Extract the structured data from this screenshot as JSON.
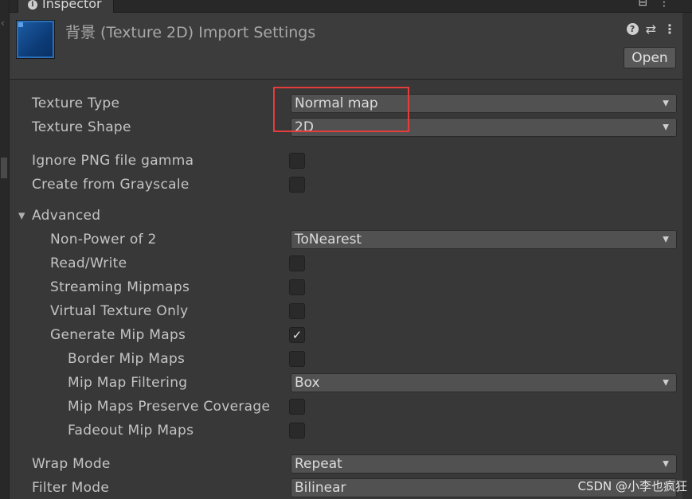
{
  "tab": {
    "label": "Inspector"
  },
  "header": {
    "title": "背景 (Texture 2D) Import Settings",
    "open_label": "Open",
    "help_icon_glyph": "?",
    "preset_icon_glyph": "⇄",
    "kebab_icon_glyph": "⋮",
    "thumbnail_color": "#1d5ea8"
  },
  "fields": {
    "texture_type": {
      "label": "Texture Type",
      "value": "Normal map"
    },
    "texture_shape": {
      "label": "Texture Shape",
      "value": "2D"
    },
    "ignore_png_gamma": {
      "label": "Ignore PNG file gamma",
      "checked": false
    },
    "create_from_grayscale": {
      "label": "Create from Grayscale",
      "checked": false
    },
    "advanced": {
      "label": "Advanced",
      "expanded": true
    },
    "non_power_of_2": {
      "label": "Non-Power of 2",
      "value": "ToNearest"
    },
    "read_write": {
      "label": "Read/Write",
      "checked": false
    },
    "streaming_mipmaps": {
      "label": "Streaming Mipmaps",
      "checked": false
    },
    "virtual_texture_only": {
      "label": "Virtual Texture Only",
      "checked": false
    },
    "generate_mip_maps": {
      "label": "Generate Mip Maps",
      "checked": true,
      "check_glyph": "✓"
    },
    "border_mip_maps": {
      "label": "Border Mip Maps",
      "checked": false
    },
    "mip_map_filtering": {
      "label": "Mip Map Filtering",
      "value": "Box"
    },
    "mip_maps_preserve_coverage": {
      "label": "Mip Maps Preserve Coverage",
      "checked": false
    },
    "fadeout_mip_maps": {
      "label": "Fadeout Mip Maps",
      "checked": false
    },
    "wrap_mode": {
      "label": "Wrap Mode",
      "value": "Repeat"
    },
    "filter_mode": {
      "label": "Filter Mode",
      "value": "Bilinear"
    }
  },
  "annotation": {
    "highlight_color": "#e53c3c"
  },
  "watermark": {
    "text": "CSDN @小李也疯狂"
  }
}
